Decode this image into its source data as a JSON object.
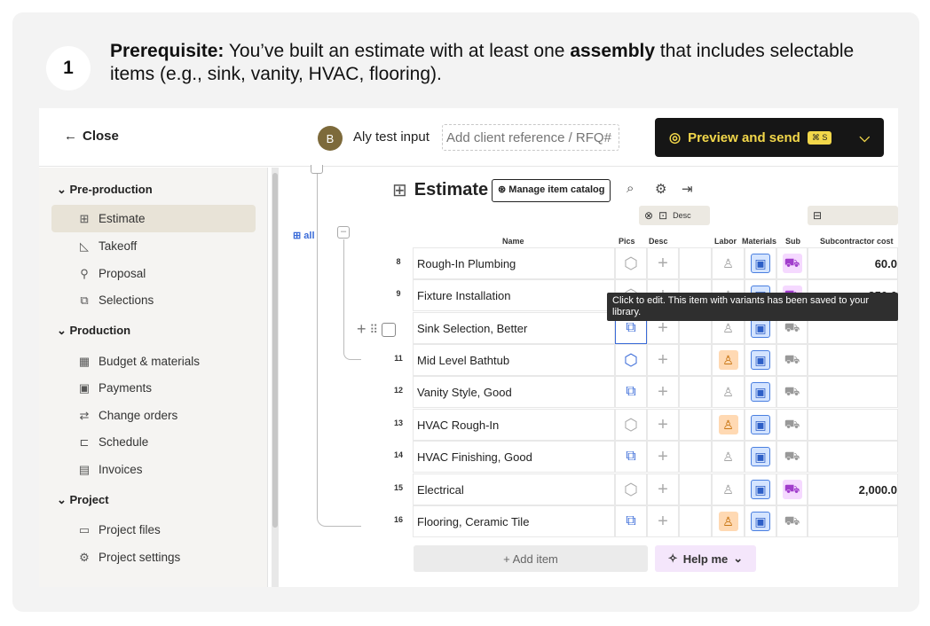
{
  "step": {
    "number": "1",
    "bold1": "Prerequisite:",
    "text1": " You’ve built an estimate with at least one ",
    "bold2": "assembly",
    "text2": " that includes selectable items (e.g., sink, vanity, HVAC, flooring)."
  },
  "topbar": {
    "close_label": "Close",
    "close_arrow": "←",
    "avatar_initial": "B",
    "project_name": "Aly test input",
    "reference_placeholder": "Add client reference / RFQ#",
    "preview_label": "Preview and send",
    "preview_shortcut": "⌘ S"
  },
  "sidebar": {
    "sections": [
      {
        "label": "Pre-production"
      },
      {
        "label": "Production"
      },
      {
        "label": "Project"
      }
    ],
    "items": [
      {
        "label": "Estimate",
        "icon": "grid-icon"
      },
      {
        "label": "Takeoff",
        "icon": "ruler-icon"
      },
      {
        "label": "Proposal",
        "icon": "proposal-icon"
      },
      {
        "label": "Selections",
        "icon": "selections-icon"
      },
      {
        "label": "Budget & materials",
        "icon": "calculator-icon"
      },
      {
        "label": "Payments",
        "icon": "payments-icon"
      },
      {
        "label": "Change orders",
        "icon": "change-orders-icon"
      },
      {
        "label": "Schedule",
        "icon": "schedule-icon"
      },
      {
        "label": "Invoices",
        "icon": "invoice-icon"
      },
      {
        "label": "Project files",
        "icon": "folder-icon"
      },
      {
        "label": "Project settings",
        "icon": "gear-icon"
      }
    ]
  },
  "estimate": {
    "title": "Estimate",
    "manage_catalog": "Manage item catalog",
    "all_label": "all",
    "group_desc": "Desc",
    "columns": {
      "name": "Name",
      "pics": "Pics",
      "desc": "Desc",
      "labor": "Labor",
      "materials": "Materials",
      "sub": "Sub",
      "subcontractor_cost": "Subcontractor cost"
    },
    "rows": [
      {
        "num": "8",
        "name": "Rough-In Plumbing",
        "cost": "60.0"
      },
      {
        "num": "9",
        "name": "Fixture Installation",
        "cost": "350.0"
      },
      {
        "num": "",
        "name": "Sink Selection, Better",
        "cost": ""
      },
      {
        "num": "11",
        "name": "Mid Level Bathtub",
        "cost": ""
      },
      {
        "num": "12",
        "name": "Vanity Style, Good",
        "cost": ""
      },
      {
        "num": "13",
        "name": "HVAC Rough-In",
        "cost": ""
      },
      {
        "num": "14",
        "name": "HVAC Finishing, Good",
        "cost": ""
      },
      {
        "num": "15",
        "name": "Electrical",
        "cost": "2,000.0"
      },
      {
        "num": "16",
        "name": "Flooring, Ceramic Tile",
        "cost": ""
      }
    ],
    "tooltip": "Click to edit. This item with variants has been saved to your library.",
    "add_item": "+ Add item",
    "help_me": "Help me"
  },
  "colors": {
    "preview_bg": "#161616",
    "preview_accent": "#f2d74a",
    "materials_blue": "#4a7fe0",
    "labor_orange": "#ffd9b3",
    "sub_purple": "#f5d9ff",
    "active_sidebar": "#e8e3d7"
  }
}
